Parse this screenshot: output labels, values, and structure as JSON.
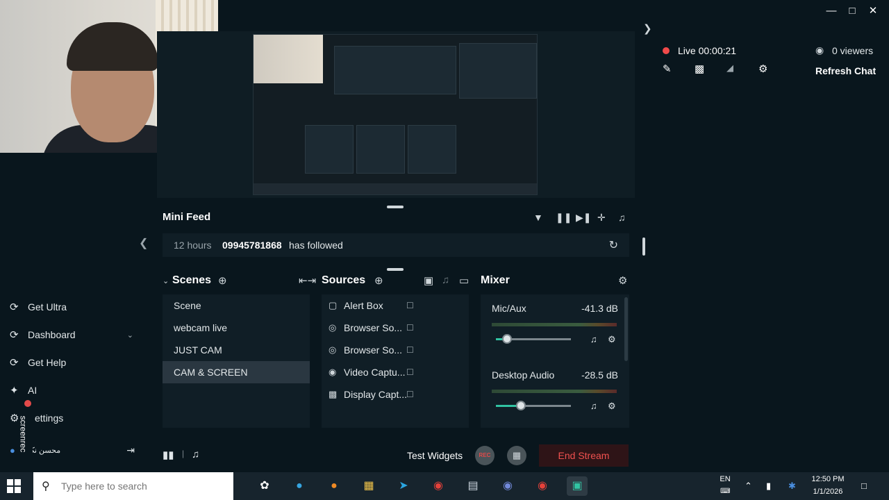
{
  "window": {
    "minimize_icon": "minimize-icon",
    "maximize_icon": "maximize-icon",
    "close_icon": "close-icon"
  },
  "nav": {
    "items": [
      {
        "label": "Get Ultra",
        "icon": "ultra-icon"
      },
      {
        "label": "Dashboard",
        "icon": "dashboard-icon"
      },
      {
        "label": "Get Help",
        "icon": "help-icon"
      },
      {
        "label": "AI",
        "icon": "sparkle-icon"
      },
      {
        "label": "ettings",
        "icon": "gear-icon"
      },
      {
        "label": "محسن نک",
        "icon": "facebook-icon"
      }
    ]
  },
  "live": {
    "status": "Live 00:00:21",
    "viewers": "0 viewers",
    "refresh_chat": "Refresh Chat",
    "live_color": "#f14a4a"
  },
  "minifeed": {
    "title": "Mini Feed",
    "time": "12 hours",
    "user": "09945781868",
    "action": "has followed"
  },
  "scenes": {
    "title": "Scenes",
    "items": [
      "Scene",
      "webcam live",
      "JUST CAM",
      "CAM & SCREEN"
    ],
    "active": "CAM & SCREEN"
  },
  "sources": {
    "title": "Sources",
    "items": [
      {
        "name": "Alert Box",
        "icon": "alert-box-icon"
      },
      {
        "name": "Browser So...",
        "icon": "globe-icon"
      },
      {
        "name": "Browser So...",
        "icon": "globe-icon"
      },
      {
        "name": "Video Captu...",
        "icon": "webcam-icon"
      },
      {
        "name": "Display Capt...",
        "icon": "monitor-icon"
      }
    ]
  },
  "mixer": {
    "title": "Mixer",
    "channels": [
      {
        "name": "Mic/Aux",
        "db": "-41.3 dB",
        "level": 0.15
      },
      {
        "name": "Desktop Audio",
        "db": "-28.5 dB",
        "level": 0.33
      }
    ]
  },
  "footer": {
    "test_widgets": "Test Widgets",
    "rec": "REC",
    "end_stream": "End Stream"
  },
  "overlay": {
    "screenrec": "screenrec"
  },
  "taskbar": {
    "search_placeholder": "Type here to search",
    "lang": "EN",
    "time": "12:50 PM",
    "date": "1/1/2026"
  }
}
